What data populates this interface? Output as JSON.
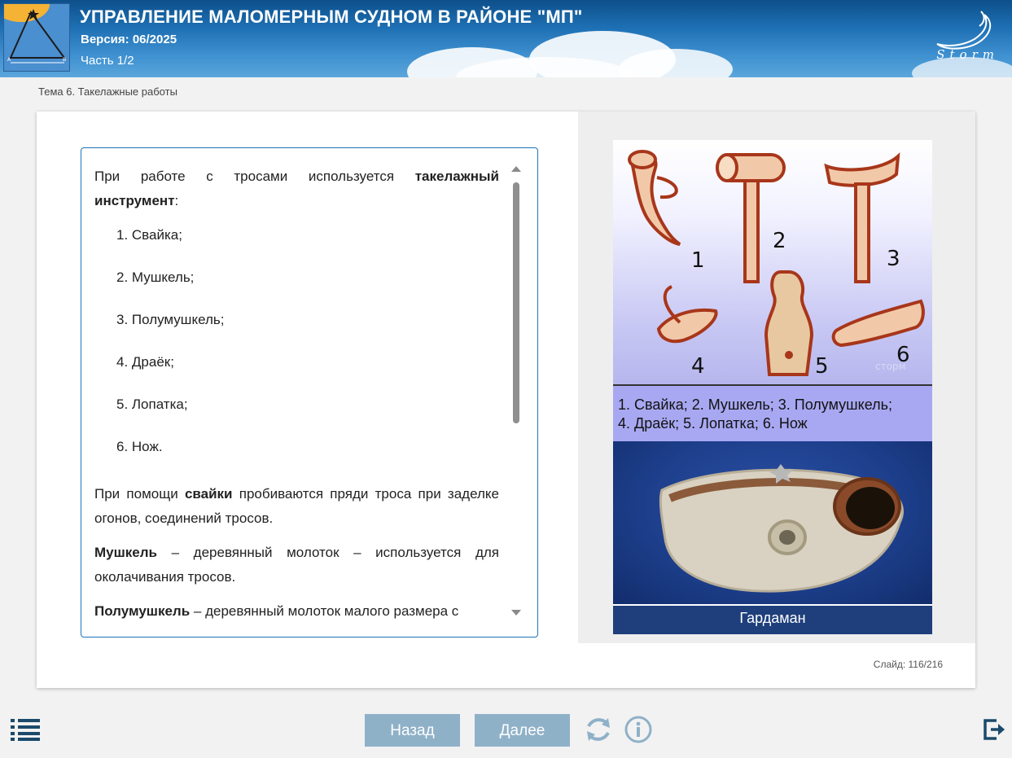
{
  "header": {
    "title": "УПРАВЛЕНИЕ МАЛОМЕРНЫМ СУДНОМ В РАЙОНЕ \"МП\"",
    "version": "Версия: 06/2025",
    "part": "Часть 1/2",
    "brand": "Storm"
  },
  "topic": "Тема 6. Такелажные работы",
  "content": {
    "intro_prefix": "При работе с тросами используется ",
    "intro_bold": "такелажный инструмент",
    "intro_suffix": ":",
    "list": [
      "1. Свайка;",
      "2. Мушкель;",
      "3. Полумушкель;",
      "4. Драёк;",
      "5. Лопатка;",
      "6. Нож."
    ],
    "p1_prefix": "При помощи ",
    "p1_bold": "свайки",
    "p1_suffix": " пробиваются пряди троса при заделке огонов, соединений тросов.",
    "p2_bold": "Мушкель",
    "p2_suffix": " – деревянный молоток – используется для околачивания тросов.",
    "p3_bold": "Полумушкель",
    "p3_suffix": " – деревянный молоток малого размера с"
  },
  "figure": {
    "numbers": [
      "1",
      "2",
      "3",
      "4",
      "5",
      "6"
    ],
    "caption_line1": "1. Свайка; 2. Мушкель; 3. Полумушкель;",
    "caption_line2": "4. Драёк; 5. Лопатка; 6. Нож",
    "photo_label": "Гардаман",
    "watermark": "сторм"
  },
  "slide_counter": "Слайд:  116/216",
  "nav": {
    "back_label": "Назад",
    "next_label": "Далее"
  },
  "colors": {
    "button": "#8fb1c8",
    "accent": "#1f73b7",
    "icon": "#1b4a6b"
  }
}
